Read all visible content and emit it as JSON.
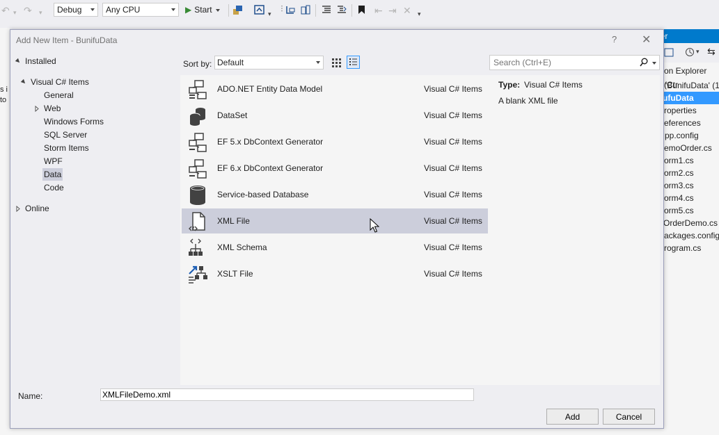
{
  "toolbar": {
    "config": "Debug",
    "platform": "Any CPU",
    "start_label": "Start"
  },
  "solution_explorer": {
    "header": "orer",
    "search_hint": "on Explorer (Ctr",
    "items": [
      {
        "label": "'BunifuData' (1"
      },
      {
        "label": "ufuData"
      },
      {
        "label": "roperties"
      },
      {
        "label": "eferences"
      },
      {
        "label": "pp.config"
      },
      {
        "label": "emoOrder.cs"
      },
      {
        "label": "orm1.cs"
      },
      {
        "label": "orm2.cs"
      },
      {
        "label": "orm3.cs"
      },
      {
        "label": "orm4.cs"
      },
      {
        "label": "orm5.cs"
      },
      {
        "label": "OrderDemo.cs"
      },
      {
        "label": "ackages.config"
      },
      {
        "label": "rogram.cs"
      }
    ]
  },
  "background_left": {
    "line1": "s i",
    "line2": "to"
  },
  "dialog": {
    "title": "Add New Item - BunifuData",
    "help": "?",
    "close": "✕",
    "tree": {
      "installed": "Installed",
      "visual_csharp": "Visual C# Items",
      "children": [
        "General",
        "Web",
        "Windows Forms",
        "SQL Server",
        "Storm Items",
        "WPF",
        "Data",
        "Code"
      ],
      "online": "Online"
    },
    "sort_label": "Sort by:",
    "sort_value": "Default",
    "search_placeholder": "Search (Ctrl+E)",
    "templates": [
      {
        "name": "ADO.NET Entity Data Model",
        "type": "Visual C# Items",
        "icon": "entity-model-icon"
      },
      {
        "name": "DataSet",
        "type": "Visual C# Items",
        "icon": "dataset-icon"
      },
      {
        "name": "EF 5.x DbContext Generator",
        "type": "Visual C# Items",
        "icon": "ef-generator-icon"
      },
      {
        "name": "EF 6.x DbContext Generator",
        "type": "Visual C# Items",
        "icon": "ef-generator-icon"
      },
      {
        "name": "Service-based Database",
        "type": "Visual C# Items",
        "icon": "database-icon"
      },
      {
        "name": "XML File",
        "type": "Visual C# Items",
        "icon": "xml-file-icon"
      },
      {
        "name": "XML Schema",
        "type": "Visual C# Items",
        "icon": "xml-schema-icon"
      },
      {
        "name": "XSLT File",
        "type": "Visual C# Items",
        "icon": "xslt-file-icon"
      }
    ],
    "details": {
      "type_label": "Type:",
      "type_value": "Visual C# Items",
      "description": "A blank XML file"
    },
    "name_label": "Name:",
    "name_value": "XMLFileDemo.xml",
    "add_label": "Add",
    "cancel_label": "Cancel"
  },
  "colors": {
    "accent": "#007acc",
    "selection": "#ccceDB",
    "panel": "#f5f5f5",
    "chrome": "#eeeef2"
  }
}
